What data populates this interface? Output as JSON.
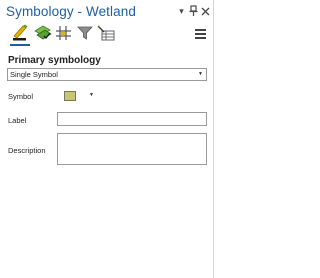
{
  "window": {
    "title": "Symbology - Wetland",
    "buttons": [
      {
        "name": "options-dropdown",
        "glyph": "▾"
      },
      {
        "name": "auto-hide-pin",
        "glyph": "pin-icon"
      },
      {
        "name": "close",
        "glyph": "close-icon"
      }
    ]
  },
  "toolbar": {
    "tools": [
      {
        "name": "primary-symbology-tab",
        "icon": "paintbrush-icon",
        "active": true
      },
      {
        "name": "vary-symbology-tab",
        "icon": "layers-icon",
        "active": false
      },
      {
        "name": "symbol-layer-drawing-tab",
        "icon": "grid-hash-icon",
        "active": false
      },
      {
        "name": "symbology-filter-tab",
        "icon": "funnel-icon",
        "active": false
      },
      {
        "name": "symbol-settings-tab",
        "icon": "table-edit-icon",
        "active": false
      }
    ],
    "menu_icon": "hamburger-menu-icon"
  },
  "primary": {
    "section_title": "Primary symbology",
    "renderer": {
      "selected": "Single Symbol"
    },
    "symbol_label": "Symbol",
    "symbol_color": "#c6c772",
    "label_label": "Label",
    "label_value": "",
    "description_label": "Description",
    "description_value": ""
  },
  "colors": {
    "title_blue": "#1f5fa8",
    "accent_green": "#5aa035",
    "accent_yellow": "#e2b400"
  }
}
